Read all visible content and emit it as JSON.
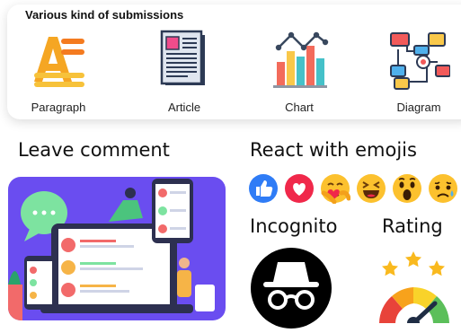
{
  "submissions": {
    "title": "Various kind of submissions",
    "items": [
      {
        "label": "Paragraph",
        "icon": "paragraph-icon"
      },
      {
        "label": "Article",
        "icon": "article-icon"
      },
      {
        "label": "Chart",
        "icon": "chart-icon"
      },
      {
        "label": "Diagram",
        "icon": "diagram-icon"
      }
    ]
  },
  "leave_comment": {
    "title": "Leave comment"
  },
  "react": {
    "title": "React with emojis",
    "emojis": [
      "like",
      "love",
      "care",
      "haha",
      "wow",
      "sad"
    ]
  },
  "incognito": {
    "title": "Incognito"
  },
  "rating": {
    "title": "Rating"
  },
  "colors": {
    "scene_bg": "#6a4df0",
    "like_blue": "#2f7cf6",
    "love_red": "#f0284a",
    "emoji_yellow": "#fcc12e",
    "star_gold": "#f9b91e"
  }
}
